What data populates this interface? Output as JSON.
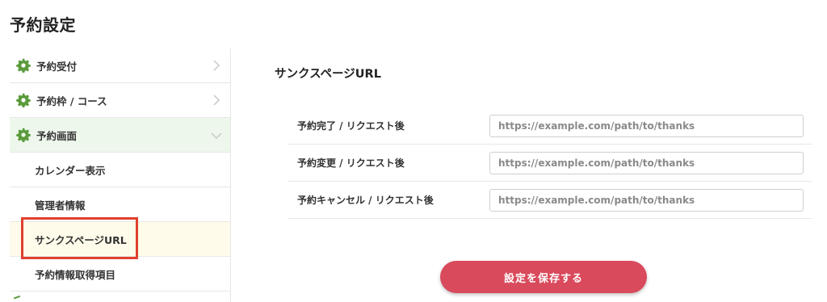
{
  "page": {
    "title": "予約設定"
  },
  "sidebar": {
    "items": [
      {
        "label": "予約受付",
        "icon": "gear-icon",
        "type": "top",
        "chevron": "right"
      },
      {
        "label": "予約枠 / コース",
        "icon": "gear-icon",
        "type": "top",
        "chevron": "right"
      },
      {
        "label": "予約画面",
        "icon": "gear-icon",
        "type": "top",
        "chevron": "down"
      },
      {
        "label": "カレンダー表示",
        "type": "sub"
      },
      {
        "label": "管理者情報",
        "type": "sub"
      },
      {
        "label": "サンクスページURL",
        "type": "sub",
        "active": true
      },
      {
        "label": "予約情報取得項目",
        "type": "sub"
      }
    ]
  },
  "main": {
    "section_title": "サンクスページURL",
    "rows": [
      {
        "label": "予約完了 / リクエスト後",
        "placeholder": "https://example.com/path/to/thanks"
      },
      {
        "label": "予約変更 / リクエスト後",
        "placeholder": "https://example.com/path/to/thanks"
      },
      {
        "label": "予約キャンセル / リクエスト後",
        "placeholder": "https://example.com/path/to/thanks"
      }
    ],
    "save_label": "設定を保存する"
  },
  "colors": {
    "accent": "#d94a5c",
    "gear": "#5a9b3c",
    "highlight": "#e0402e"
  }
}
